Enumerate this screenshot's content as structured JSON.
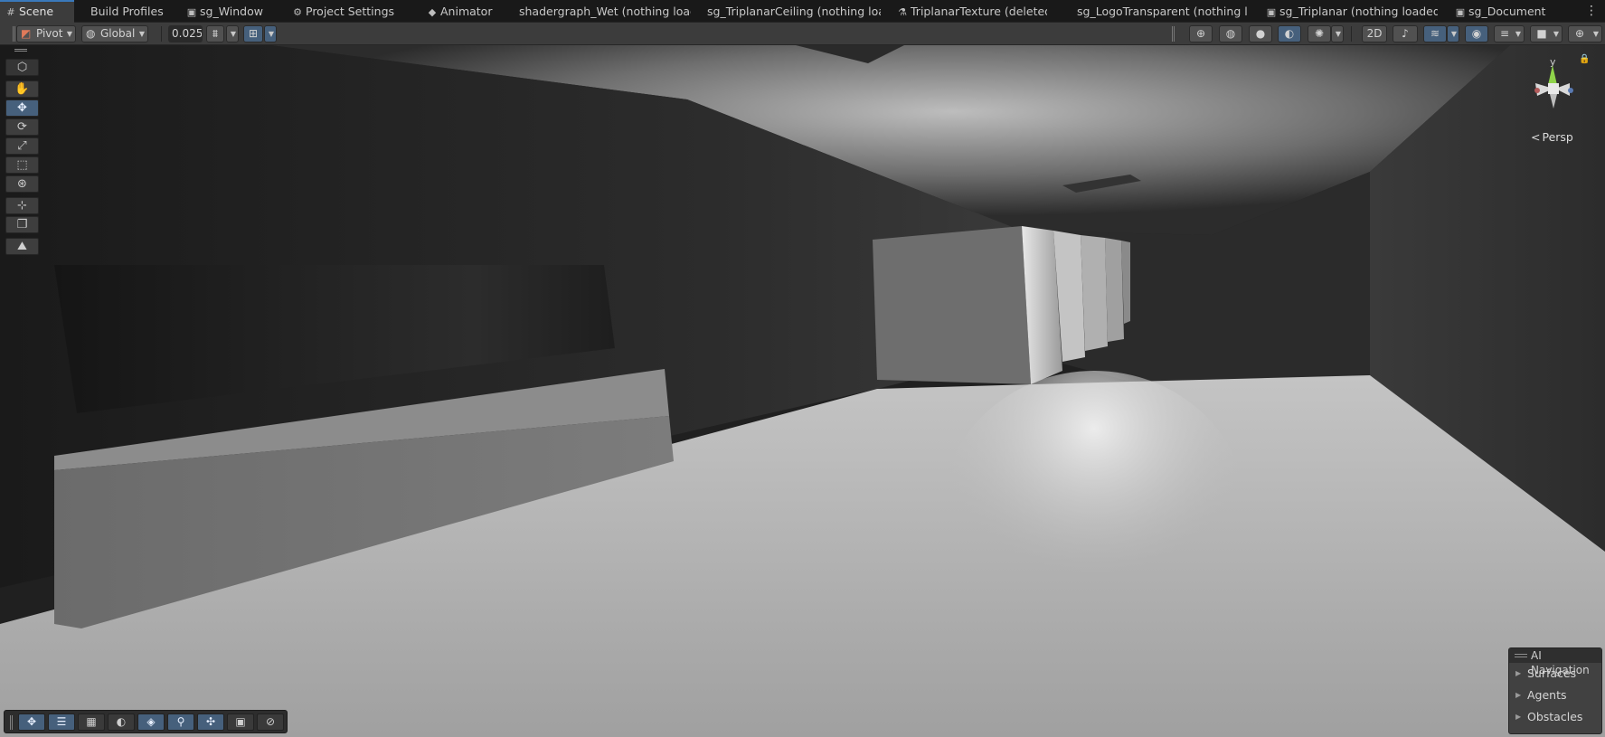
{
  "tabs": [
    {
      "label": "Scene",
      "icon": "hash-icon",
      "active": true
    },
    {
      "label": "Build Profiles",
      "icon": ""
    },
    {
      "label": "sg_Window",
      "icon": "shader-graph-icon"
    },
    {
      "label": "Project Settings",
      "icon": "gear-icon"
    },
    {
      "label": "Animator",
      "icon": "animator-icon"
    },
    {
      "label": "shadergraph_Wet (nothing loade",
      "icon": ""
    },
    {
      "label": "sg_TriplanarCeiling (nothing load",
      "icon": ""
    },
    {
      "label": "TriplanarTexture (deleted)",
      "icon": "graph-icon"
    },
    {
      "label": "sg_LogoTransparent (nothing lo...",
      "icon": ""
    },
    {
      "label": "sg_Triplanar (nothing loaded)",
      "icon": "shader-graph-icon"
    },
    {
      "label": "sg_Document",
      "icon": "shader-graph-icon"
    }
  ],
  "tab_more_icon": "kebab-menu-icon",
  "toolbar": {
    "pivot_label": "Pivot",
    "global_label": "Global",
    "snap_value": "0.025",
    "right_icons": [
      "wireframe-icon",
      "shaded-wire-icon",
      "shaded-icon",
      "lighting-toggle-icon",
      "effects-icon",
      "2d-toggle-icon",
      "audio-toggle-icon",
      "layers-icon",
      "visibility-icon",
      "overlays-icon",
      "camera-icon",
      "gizmos-icon"
    ]
  },
  "tools": [
    "view-cube-icon",
    "hand-tool-icon",
    "move-tool-icon",
    "rotate-tool-icon",
    "scale-tool-icon",
    "rect-tool-icon",
    "transform-tool-icon",
    "custom-tool-icon",
    "duplicate-tool-icon",
    "terrain-tool-icon"
  ],
  "gizmo": {
    "axis_label": "y",
    "view_label": "Persp"
  },
  "ai_navigation": {
    "title": "AI Navigation",
    "items": [
      "Surfaces",
      "Agents",
      "Obstacles"
    ]
  },
  "bottom_tools": [
    "move-icon",
    "inspector-icon",
    "grid-icon",
    "lighting-icon",
    "layers-icon",
    "search-icon",
    "snap-icon",
    "camera-icon",
    "compass-icon"
  ],
  "colors": {
    "accent": "#46607c",
    "active_tab_line": "#3a79bb",
    "panel": "#3c3c3c"
  }
}
